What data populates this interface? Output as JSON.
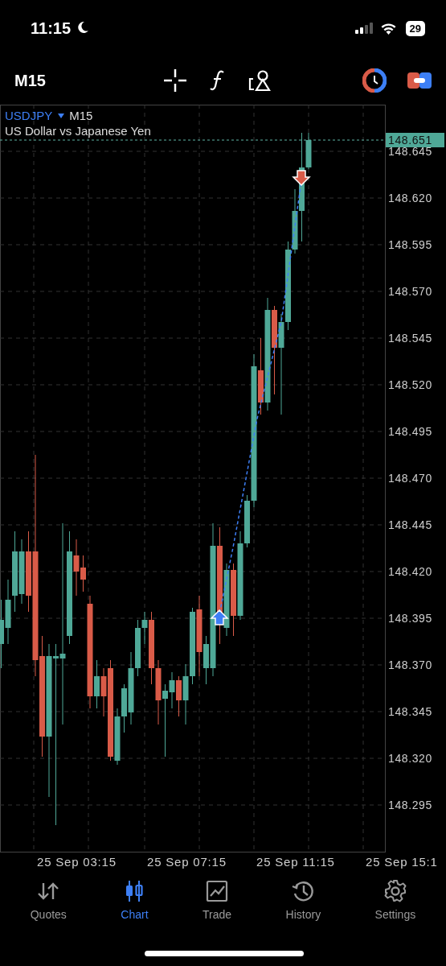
{
  "status_bar": {
    "time": "11:15",
    "battery": "29"
  },
  "toolbar": {
    "timeframe": "M15"
  },
  "chart": {
    "symbol": "USDJPY",
    "timeframe": "M15",
    "description": "US Dollar vs Japanese Yen",
    "current_price": "148.651",
    "price_labels": [
      "148.645",
      "148.620",
      "148.595",
      "148.570",
      "148.545",
      "148.520",
      "148.495",
      "148.470",
      "148.445",
      "148.420",
      "148.395",
      "148.370",
      "148.345",
      "148.320",
      "148.295"
    ],
    "time_labels": [
      "25 Sep 03:15",
      "25 Sep 07:15",
      "25 Sep 11:15",
      "25 Sep 15:1"
    ]
  },
  "tabs": [
    {
      "label": "Quotes",
      "kind": "quotes",
      "selected": false
    },
    {
      "label": "Chart",
      "kind": "chart",
      "selected": true
    },
    {
      "label": "Trade",
      "kind": "trade",
      "selected": false
    },
    {
      "label": "History",
      "kind": "history",
      "selected": false
    },
    {
      "label": "Settings",
      "kind": "settings",
      "selected": false
    }
  ]
}
